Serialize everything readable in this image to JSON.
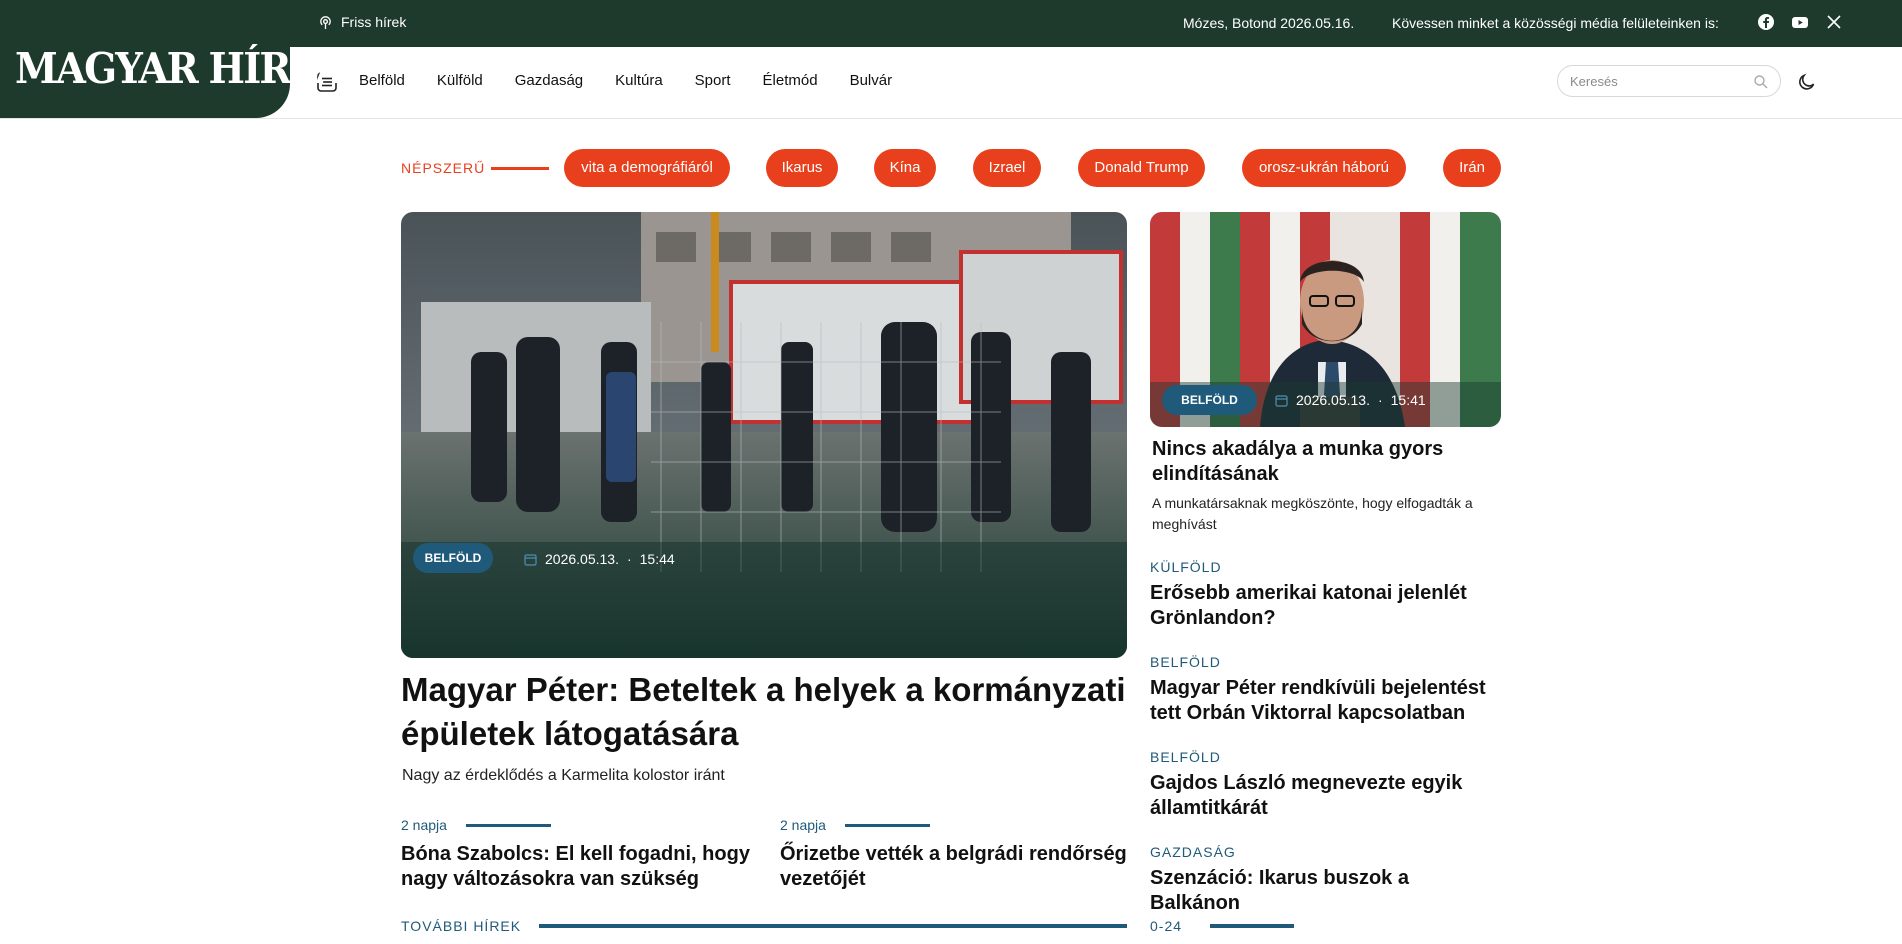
{
  "topbar": {
    "live_label": "Friss hírek",
    "nameday": "Mózes, Botond 2026.05.16.",
    "follow_text": "Kövessen minket a közösségi média felületeinken is:",
    "social": [
      "facebook-icon",
      "youtube-icon",
      "x-icon"
    ]
  },
  "logo": {
    "text_big": "MAGYAR HÍRLAP"
  },
  "nav": {
    "items": [
      "Belföld",
      "Külföld",
      "Gazdaság",
      "Kultúra",
      "Sport",
      "Életmód",
      "Bulvár"
    ]
  },
  "search": {
    "placeholder": "Keresés"
  },
  "popular": {
    "label": "NÉPSZERŰ",
    "tags": [
      "vita a demográfiáról",
      "Ikarus",
      "Kína",
      "Izrael",
      "Donald Trump",
      "orosz-ukrán háború",
      "Irán"
    ]
  },
  "hero": {
    "category": "BELFÖLD",
    "date": "2026.05.13.",
    "time": "15:44",
    "title": "Magyar Péter: Beteltek a helyek a kormányzati épületek látogatására",
    "lead": "Nagy az érdeklődés a Karmelita kolostor iránt"
  },
  "small_articles": [
    {
      "time": "2 napja",
      "title": "Bóna Szabolcs: El kell fogadni, hogy nagy változásokra van szükség"
    },
    {
      "time": "2 napja",
      "title": "Őrizetbe vették a belgrádi rendőrség vezetőjét"
    }
  ],
  "more_news_label": "TOVÁBBI HÍREK",
  "day_label": "0-24",
  "side_feature": {
    "category": "BELFÖLD",
    "date": "2026.05.13.",
    "time": "15:41",
    "title": "Nincs akadálya a munka gyors elindításának",
    "lead": "A munkatársaknak megköszönte, hogy elfogadták a meghívást"
  },
  "side_list": [
    {
      "category": "KÜLFÖLD",
      "title": "Erősebb amerikai katonai jelenlét Grönlandon?"
    },
    {
      "category": "BELFÖLD",
      "title": "Magyar Péter rendkívüli bejelentést tett Orbán Viktorral kapcsolatban"
    },
    {
      "category": "BELFÖLD",
      "title": "Gajdos László megnevezte egyik államtitkárát"
    },
    {
      "category": "GAZDASÁG",
      "title": "Szenzáció: Ikarus buszok a Balkánon"
    }
  ],
  "colors": {
    "brand_green": "#1e3a2c",
    "accent_red": "#e8401c",
    "accent_blue": "#1f5a7a"
  }
}
